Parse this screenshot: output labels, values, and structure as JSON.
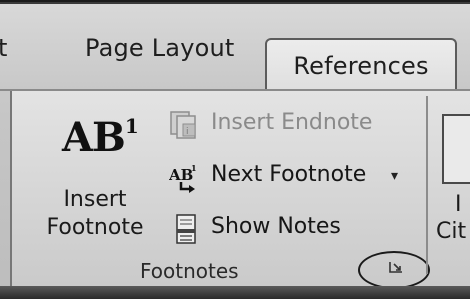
{
  "tabs": [
    {
      "label": "t"
    },
    {
      "label": "Page Layout"
    },
    {
      "label": "References"
    }
  ],
  "footnotes_group": {
    "insert_footnote": {
      "icon_text": "AB",
      "icon_sup": "1",
      "label_line1": "Insert",
      "label_line2": "Footnote"
    },
    "insert_endnote": {
      "label": "Insert Endnote",
      "enabled": false
    },
    "next_footnote": {
      "label": "Next Footnote",
      "caret": "▾"
    },
    "show_notes": {
      "label": "Show Notes"
    },
    "group_label": "Footnotes"
  },
  "citations_group": {
    "label_letter": "I",
    "label_partial": "Cit"
  }
}
